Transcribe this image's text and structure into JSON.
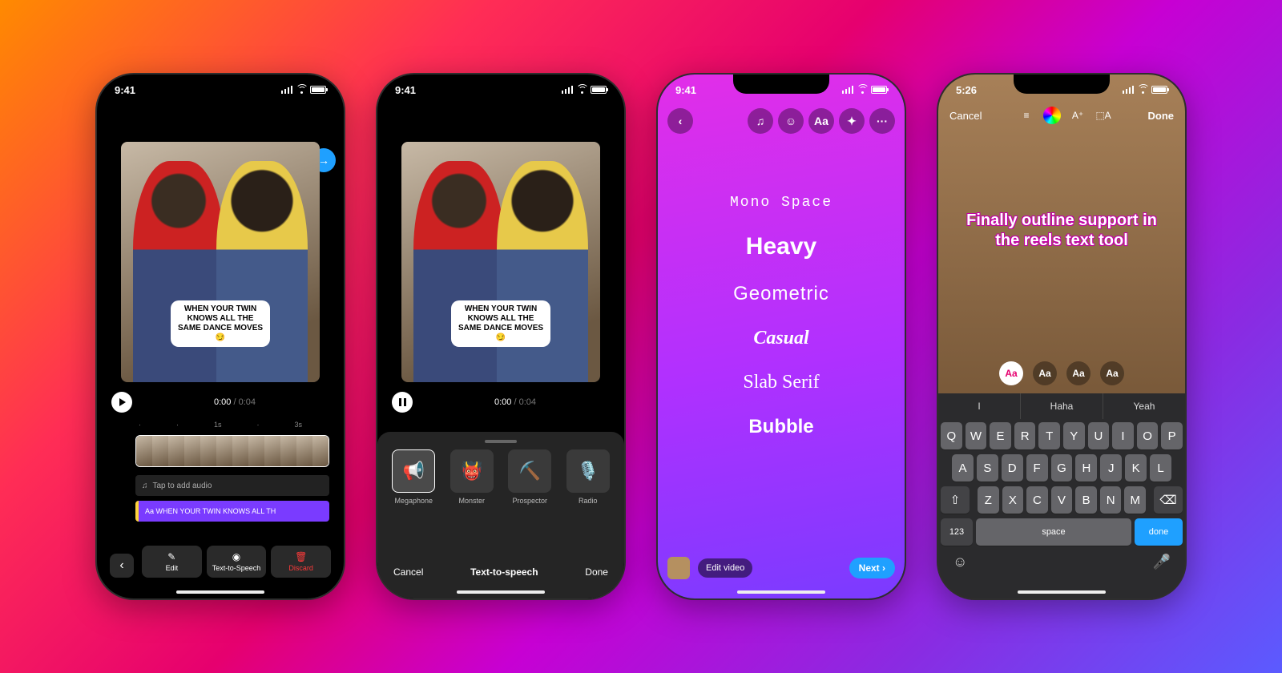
{
  "common": {
    "time": "9:41"
  },
  "p1": {
    "caption": "WHEN YOUR TWIN KNOWS ALL THE SAME DANCE MOVES😏",
    "timecode": "0:00",
    "duration": "0:04",
    "ticks": [
      "·",
      "·",
      "1s",
      "·",
      "3s"
    ],
    "audioHint": "Tap to add audio",
    "textTrack": "Aa WHEN YOUR TWIN KNOWS ALL TH",
    "buttons": {
      "edit": "Edit",
      "tts": "Text-to-Speech",
      "discard": "Discard"
    }
  },
  "p2": {
    "caption": "WHEN YOUR TWIN KNOWS ALL THE SAME DANCE MOVES😏",
    "timecode": "0:00",
    "duration": "0:04",
    "voices": [
      "Megaphone",
      "Monster",
      "Prospector",
      "Radio"
    ],
    "voiceIcons": [
      "📢",
      "👹",
      "⛏️",
      "🎙️"
    ],
    "cancel": "Cancel",
    "title": "Text-to-speech",
    "done": "Done"
  },
  "p3": {
    "fonts": [
      "Mono Space",
      "Heavy",
      "Geometric",
      "Casual",
      "Slab Serif",
      "Bubble"
    ],
    "editVideo": "Edit video",
    "next": "Next ›",
    "toolbar": [
      "♫",
      "☺",
      "Aa",
      "✦",
      "···"
    ]
  },
  "p4": {
    "time": "5:26",
    "cancel": "Cancel",
    "done": "Done",
    "overlay": "Finally outline support in the reels text tool",
    "styleLabels": [
      "Aa",
      "Aa",
      "Aa",
      "Aa"
    ],
    "suggestions": [
      "I",
      "Haha",
      "Yeah"
    ],
    "rows": [
      [
        "Q",
        "W",
        "E",
        "R",
        "T",
        "Y",
        "U",
        "I",
        "O",
        "P"
      ],
      [
        "A",
        "S",
        "D",
        "F",
        "G",
        "H",
        "J",
        "K",
        "L"
      ],
      [
        "Z",
        "X",
        "C",
        "V",
        "B",
        "N",
        "M"
      ]
    ],
    "num": "123",
    "space": "space",
    "kdone": "done",
    "shift": "⇧",
    "del": "⌫",
    "emoji": "☺",
    "mic": "🎤"
  }
}
